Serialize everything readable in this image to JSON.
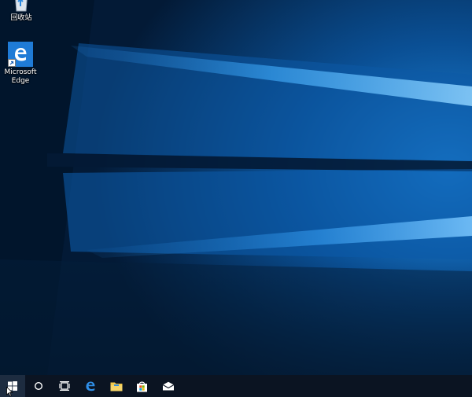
{
  "desktop": {
    "icons": [
      {
        "label": "回收站",
        "icon": "recycle-bin-icon"
      },
      {
        "label": "Microsoft\nEdge",
        "icon": "edge-icon"
      }
    ]
  },
  "taskbar": {
    "items": [
      {
        "icon": "windows-start-icon"
      },
      {
        "icon": "cortana-search-icon"
      },
      {
        "icon": "task-view-icon"
      },
      {
        "icon": "edge-icon"
      },
      {
        "icon": "file-explorer-icon"
      },
      {
        "icon": "store-icon"
      },
      {
        "icon": "mail-icon"
      }
    ]
  },
  "colors": {
    "wallpaper_dark": "#03172e",
    "wallpaper_light": "#1a8ae0",
    "taskbar": "#0b1422",
    "edge_blue": "#1f7bd6",
    "explorer_yellow": "#f2c94c"
  }
}
